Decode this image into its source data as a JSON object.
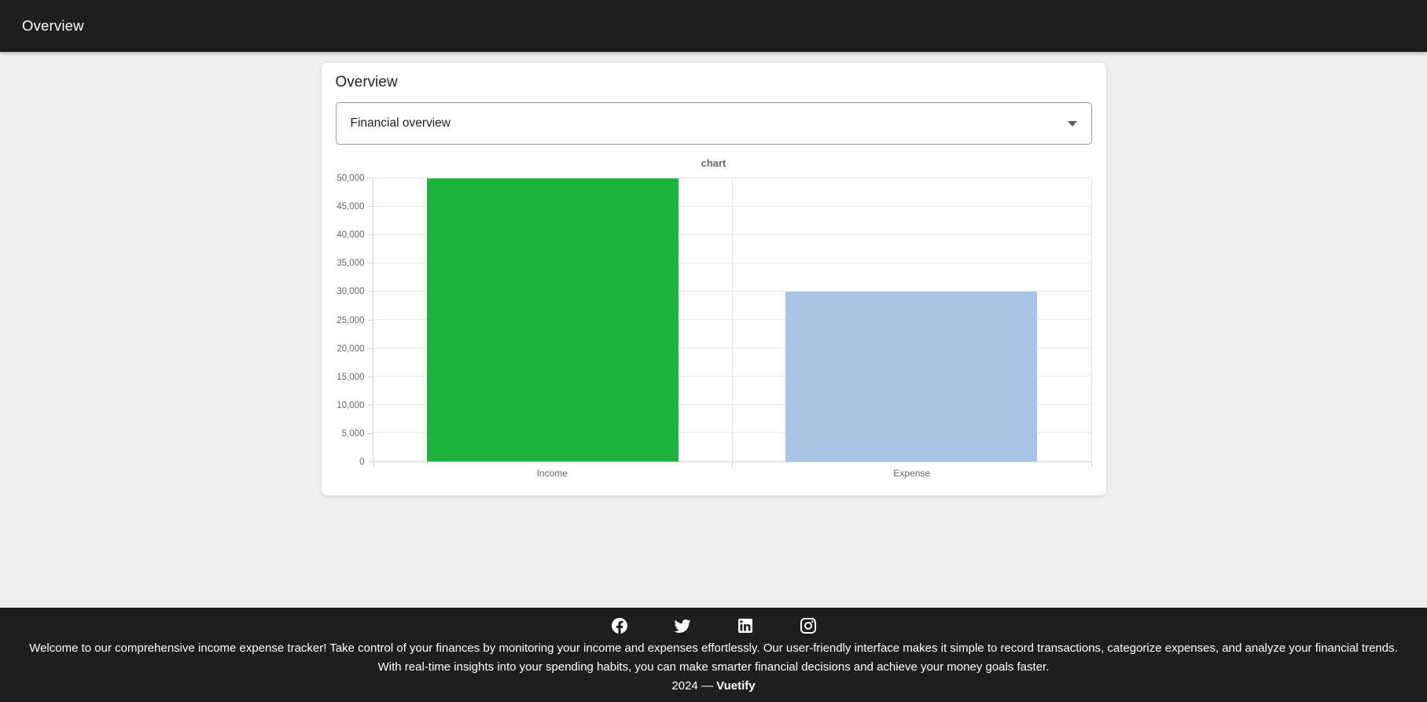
{
  "header": {
    "title": "Overview"
  },
  "card": {
    "title": "Overview",
    "select": {
      "value": "Financial overview",
      "caret_icon": "chevron-down-icon"
    }
  },
  "chart_data": {
    "type": "bar",
    "title": "chart",
    "categories": [
      "Income",
      "Expense"
    ],
    "values": [
      50000,
      30000
    ],
    "bar_colors": [
      "#21b23c",
      "#aac4e8"
    ],
    "ylim": [
      0,
      50000
    ],
    "ytick_step": 5000,
    "ytick_labels": [
      "0",
      "5,000",
      "10,000",
      "15,000",
      "20,000",
      "25,000",
      "30,000",
      "35,000",
      "40,000",
      "45,000",
      "50,000"
    ],
    "grid": true,
    "legend_position": "none"
  },
  "footer": {
    "social_icons": [
      "facebook-icon",
      "twitter-icon",
      "linkedin-icon",
      "instagram-icon"
    ],
    "description": "Welcome to our comprehensive income expense tracker! Take control of your finances by monitoring your income and expenses effortlessly. Our user-friendly interface makes it simple to record transactions, categorize expenses, and analyze your financial trends. With real-time insights into your spending habits, you can make smarter financial decisions and achieve your money goals faster.",
    "year_prefix": "2024 — ",
    "brand": "Vuetify"
  },
  "colors": {
    "header_bg": "#1e1e1e",
    "page_bg": "#eeeeee",
    "income_bar": "#21b23c",
    "expense_bar": "#aac4e8",
    "muted_text": "#666666"
  }
}
